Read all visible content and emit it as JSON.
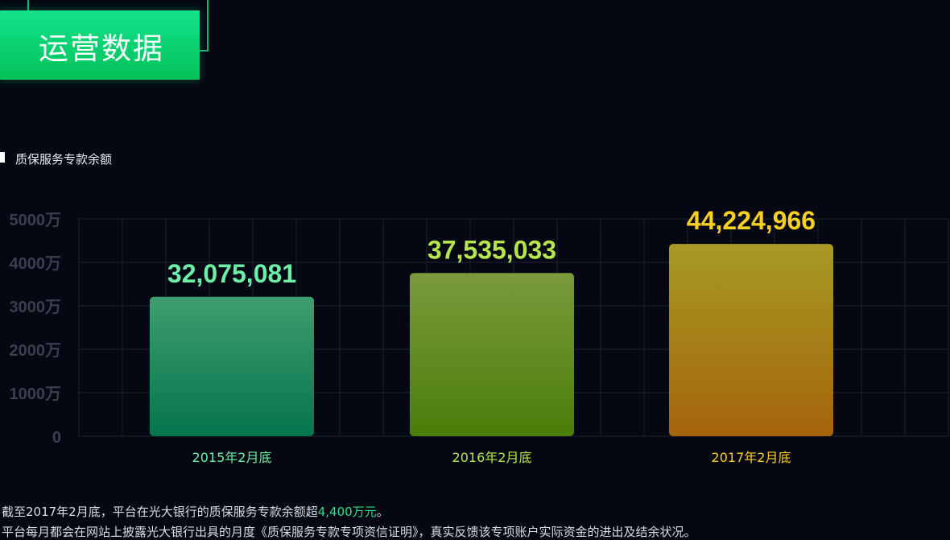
{
  "header": {
    "title": "运营数据"
  },
  "subtitle": "质保服务专款余额",
  "chart_data": {
    "type": "bar",
    "categories": [
      "2015年2月底",
      "2016年2月底",
      "2017年2月底"
    ],
    "values": [
      32075081,
      37535033,
      44224966
    ],
    "value_labels": [
      "32,075,081",
      "37,535,033",
      "44,224,966"
    ],
    "ylim": [
      0,
      50000000
    ],
    "yticks": [
      0,
      10000000,
      20000000,
      30000000,
      40000000,
      50000000
    ],
    "ytick_labels": [
      "0",
      "1000万",
      "2000万",
      "3000万",
      "4000万",
      "5000万"
    ],
    "grid": true,
    "colors": {
      "bar_top": [
        "#3e9e6e",
        "#7b9a3c",
        "#a69a24"
      ],
      "bar_bottom": [
        "#05744d",
        "#4a7d09",
        "#a5640b"
      ],
      "label": [
        "#6eefa7",
        "#b4e64b",
        "#f7d020"
      ]
    }
  },
  "notes": {
    "line1_prefix": "截至2017年2月底，平台在光大银行的质保服务专款余额超",
    "line1_highlight": "4,400万元",
    "line1_suffix": "。",
    "line2": "平台每月都会在网站上披露光大银行出具的月度《质保服务专款专项资信证明》，真实反馈该专项账户实际资金的进出及结余状况。"
  }
}
